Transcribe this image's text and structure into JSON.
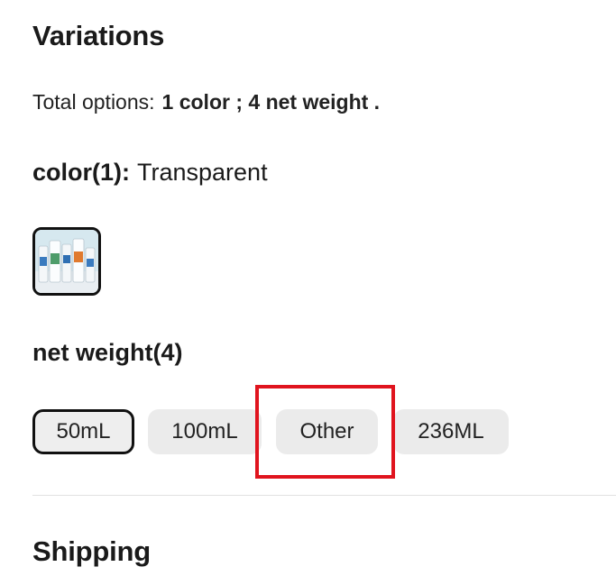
{
  "variations": {
    "title": "Variations",
    "total_options_label": "Total options:",
    "total_options_value": "1 color ; 4 net weight ."
  },
  "color": {
    "label": "color(1):",
    "selected": "Transparent",
    "swatches": [
      {
        "name": "Transparent",
        "icon": "product-bottles-thumbnail",
        "selected": true
      }
    ]
  },
  "net_weight": {
    "label": "net weight(4)",
    "options": [
      {
        "label": "50mL",
        "selected": true
      },
      {
        "label": "100mL",
        "selected": false
      },
      {
        "label": "Other",
        "selected": false,
        "highlighted": true
      },
      {
        "label": "236ML",
        "selected": false
      }
    ]
  },
  "shipping": {
    "title": "Shipping"
  },
  "colors": {
    "text": "#1a1a1a",
    "chip_bg": "#ebebeb",
    "selected_border": "#111111",
    "highlight": "#e0141e",
    "divider": "#e2e2e2"
  }
}
